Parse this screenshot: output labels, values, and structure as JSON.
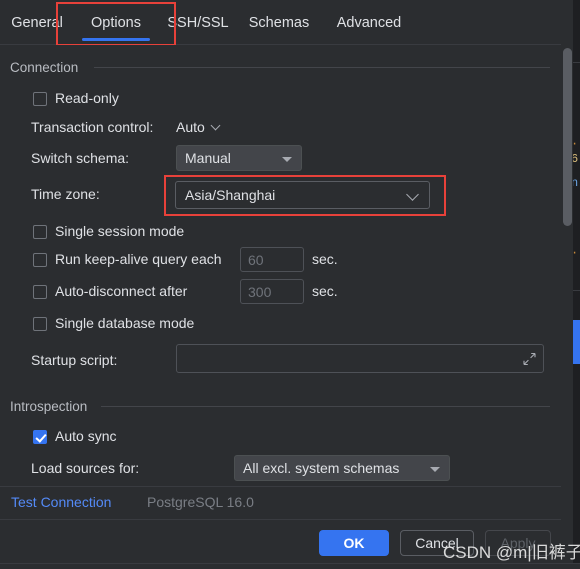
{
  "colors": {
    "background": "#2b2d30",
    "accent": "#3574f0",
    "link": "#548af7",
    "highlight_box": "#e8413a",
    "text": "#dfe1e5",
    "muted_text": "#7a7e85"
  },
  "tabs": [
    {
      "label": "General",
      "selected": false
    },
    {
      "label": "Options",
      "selected": true
    },
    {
      "label": "SSH/SSL",
      "selected": false
    },
    {
      "label": "Schemas",
      "selected": false
    },
    {
      "label": "Advanced",
      "selected": false
    }
  ],
  "groups": {
    "connection": {
      "title": "Connection"
    },
    "introspection": {
      "title": "Introspection"
    }
  },
  "connection": {
    "read_only": {
      "label": "Read-only",
      "checked": false
    },
    "transaction_control": {
      "label": "Transaction control:",
      "value": "Auto"
    },
    "switch_schema": {
      "label": "Switch schema:",
      "value": "Manual"
    },
    "time_zone": {
      "label": "Time zone:",
      "value": "Asia/Shanghai"
    },
    "single_session_mode": {
      "label": "Single session mode",
      "checked": false
    },
    "keep_alive": {
      "label": "Run keep-alive query each",
      "checked": false,
      "value": "60",
      "unit": "sec."
    },
    "auto_disconnect": {
      "label": "Auto-disconnect after",
      "checked": false,
      "value": "300",
      "unit": "sec."
    },
    "single_database_mode": {
      "label": "Single database mode",
      "checked": false
    },
    "startup_script": {
      "label": "Startup script:",
      "value": "",
      "expand_icon": "expand-diagonal-icon"
    }
  },
  "introspection": {
    "auto_sync": {
      "label": "Auto sync",
      "checked": true
    },
    "load_sources_for": {
      "label": "Load sources for:",
      "value": "All excl. system schemas"
    }
  },
  "status": {
    "test_connection": "Test Connection",
    "driver_version": "PostgreSQL 16.0"
  },
  "footer": {
    "ok": "OK",
    "cancel": "Cancel",
    "apply": "Apply"
  },
  "watermark": "CSDN @m|旧裤子",
  "bleed": {
    "lines": [
      "6",
      "n",
      "·"
    ]
  }
}
